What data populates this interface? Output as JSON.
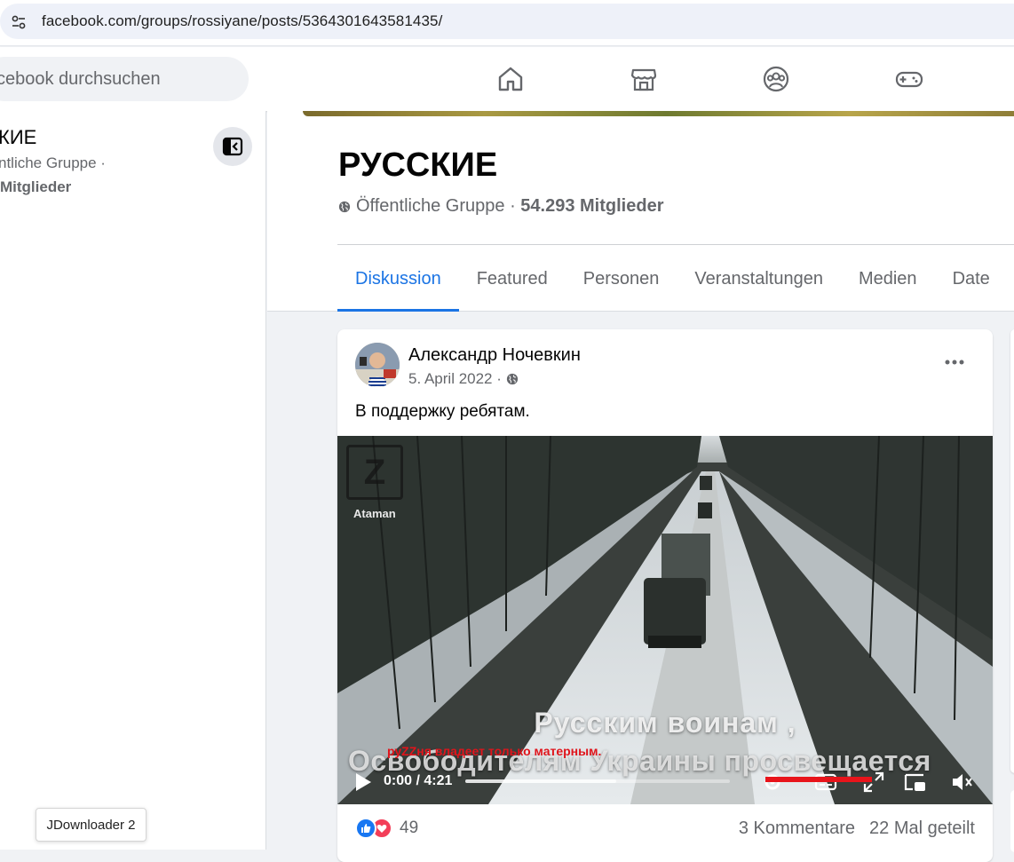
{
  "browser": {
    "url": "facebook.com/groups/rossiyane/posts/5364301643581435/"
  },
  "header": {
    "search_placeholder": "cebook durchsuchen",
    "nav_icons": [
      "home-icon",
      "marketplace-icon",
      "groups-icon",
      "gaming-icon"
    ]
  },
  "left_panel": {
    "title": "КИЕ",
    "subtitle": "ntliche Gruppe ·",
    "members": "Mitglieder"
  },
  "group": {
    "title": "РУССКИЕ",
    "visibility": "Öffentliche Gruppe",
    "separator": " · ",
    "members": "54.293 Mitglieder",
    "tabs": [
      {
        "label": "Diskussion",
        "active": true
      },
      {
        "label": "Featured",
        "active": false
      },
      {
        "label": "Personen",
        "active": false
      },
      {
        "label": "Veranstaltungen",
        "active": false
      },
      {
        "label": "Medien",
        "active": false
      },
      {
        "label": "Date",
        "active": false
      }
    ]
  },
  "post": {
    "author": "Александр Ночевкин",
    "date": "5. April 2022 ·",
    "text": "В поддержку ребятам.",
    "video": {
      "watermark_letter": "Z",
      "watermark_label": "Ataman",
      "subtitle_line1": "Русским воинам ,",
      "subtitle_line2": "Освободителям Украины просвещается",
      "time": "0:00 / 4:21",
      "buffered_fraction": 0.57
    },
    "reaction_count": "49",
    "comments": "3 Kommentare",
    "shares": "22 Mal geteilt",
    "overlay_caption": "руZZня владеет только матерным."
  },
  "tooltip": {
    "label": "JDownloader 2"
  },
  "colors": {
    "accent": "#1b74e4",
    "like": "#1877f2",
    "love": "#f33e58",
    "red_overlay": "#e8141b"
  }
}
